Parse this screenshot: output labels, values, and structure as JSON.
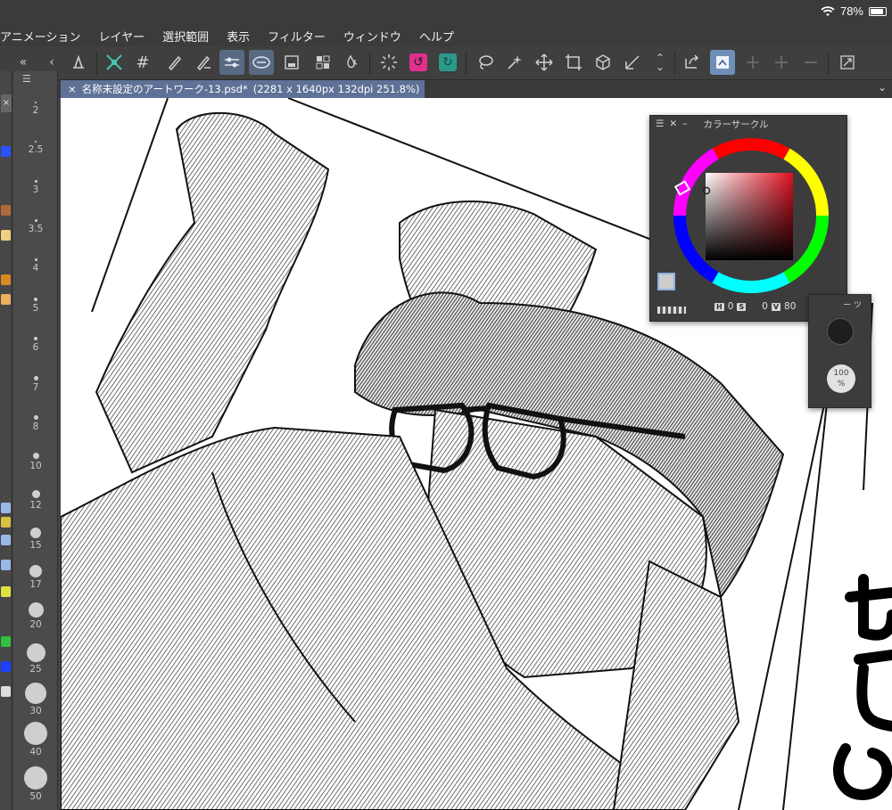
{
  "status": {
    "battery": "78%"
  },
  "menu": [
    "アニメーション",
    "レイヤー",
    "選択範囲",
    "表示",
    "フィルター",
    "ウィンドウ",
    "ヘルプ"
  ],
  "document_tab": {
    "title": "名称未設定のアートワーク-13.psd*",
    "info": "(2281 x 1640px 132dpi 251.8%)"
  },
  "brush_sizes": [
    "2",
    "2.5",
    "3",
    "3.5",
    "4",
    "5",
    "6",
    "7",
    "8",
    "10",
    "12",
    "15",
    "17",
    "20",
    "25",
    "30",
    "40",
    "50"
  ],
  "color_panel": {
    "title": "カラーサークル",
    "h_label": "H",
    "h_value": "0",
    "s_label": "S",
    "s_value": "0",
    "v_label": "V",
    "v_value": "80",
    "current_color": "#cccccc"
  },
  "mini_panel": {
    "title": "ー ツ",
    "opacity": "100\n%"
  },
  "colors": {
    "accent": "#586a82",
    "tab": "#5e7196",
    "magenta": "#e0308c",
    "teal": "#2a9a8a"
  }
}
